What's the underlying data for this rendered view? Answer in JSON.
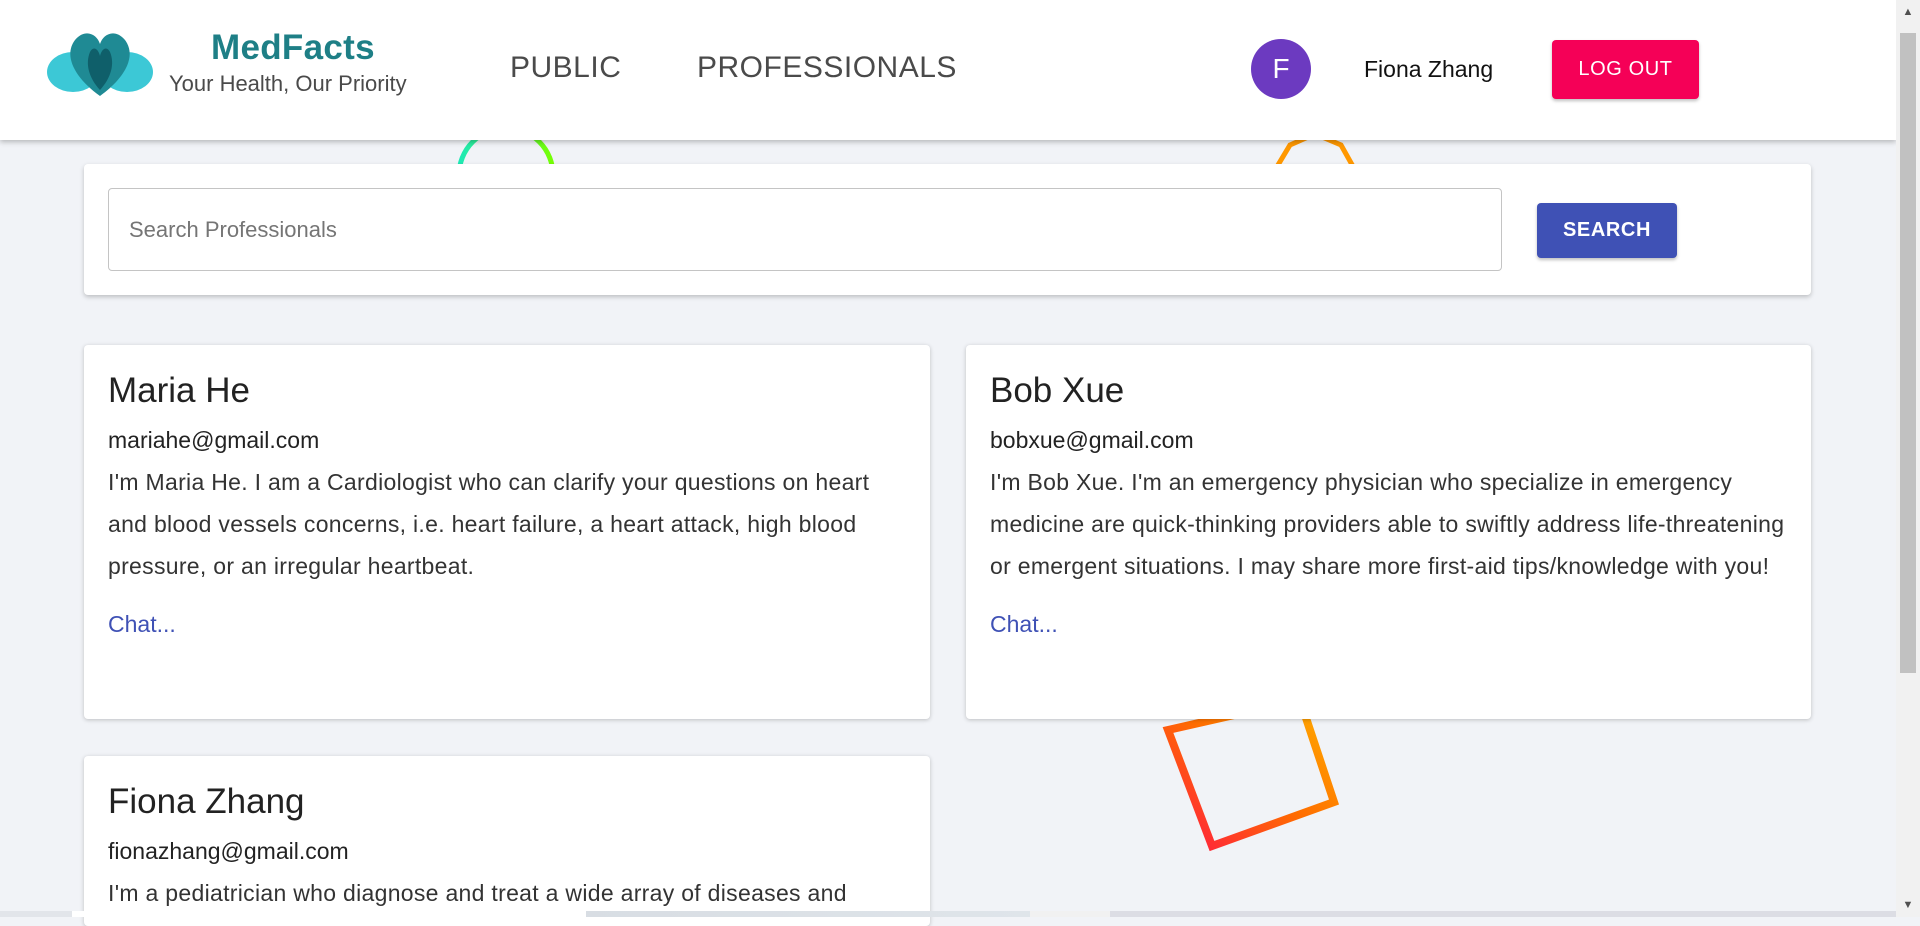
{
  "brand": {
    "name": "MedFacts",
    "tagline": "Your Health, Our Priority"
  },
  "nav": {
    "links": [
      "PUBLIC",
      "PROFESSIONALS"
    ]
  },
  "user": {
    "avatar_initial": "F",
    "name": "Fiona Zhang",
    "logout_label": "LOG OUT"
  },
  "search": {
    "placeholder": "Search Professionals",
    "value": "",
    "button_label": "SEARCH"
  },
  "professionals": [
    {
      "name": "Maria He",
      "email": "mariahe@gmail.com",
      "bio": "I'm Maria He. I am a Cardiologist who can clarify your questions on heart and blood vessels concerns, i.e. heart failure, a heart attack, high blood pressure, or an irregular heartbeat.",
      "chat_label": "Chat..."
    },
    {
      "name": "Bob Xue",
      "email": "bobxue@gmail.com",
      "bio": "I'm Bob Xue. I'm an emergency physician who specialize in emergency medicine are quick-thinking providers able to swiftly address life-threatening or emergent situations. I may share more first-aid tips/knowledge with you!",
      "chat_label": "Chat..."
    },
    {
      "name": "Fiona Zhang",
      "email": "fionazhang@gmail.com",
      "bio": "I'm a pediatrician who diagnose and treat a wide array of diseases and",
      "chat_label": ""
    }
  ],
  "colors": {
    "brand_teal": "#1e7f86",
    "avatar_purple": "#6c3ac0",
    "logout_pink": "#f50057",
    "primary_blue": "#3f51b5"
  }
}
